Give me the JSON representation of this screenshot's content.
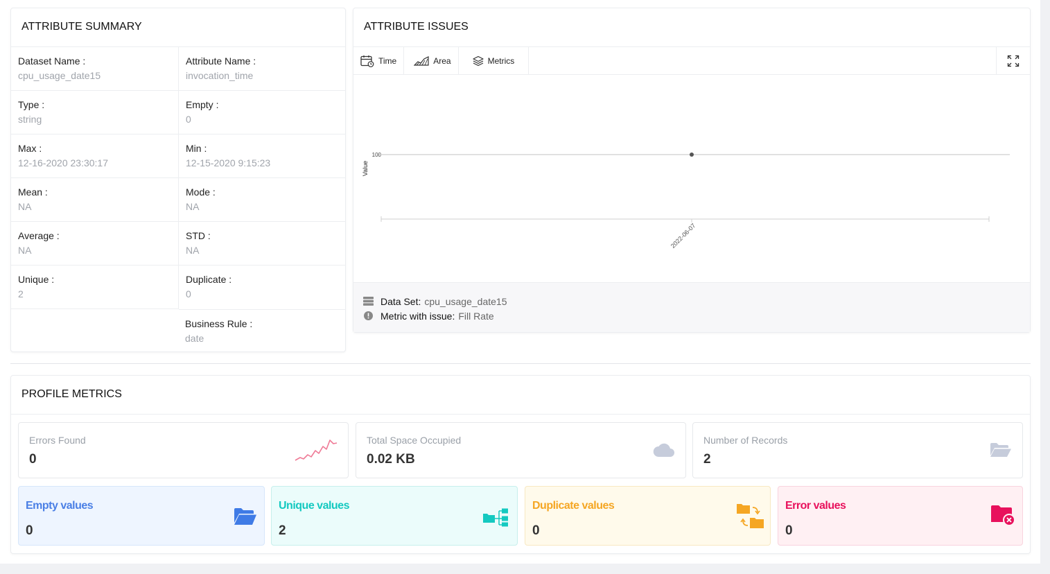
{
  "summary": {
    "title": "ATTRIBUTE SUMMARY",
    "fields": [
      {
        "label": "Dataset Name :",
        "value": "cpu_usage_date15"
      },
      {
        "label": "Attribute Name :",
        "value": "invocation_time"
      },
      {
        "label": "Type :",
        "value": "string"
      },
      {
        "label": "Empty :",
        "value": "0"
      },
      {
        "label": "Max :",
        "value": "12-16-2020 23:30:17"
      },
      {
        "label": "Min :",
        "value": "12-15-2020 9:15:23"
      },
      {
        "label": "Mean :",
        "value": "NA"
      },
      {
        "label": "Mode :",
        "value": "NA"
      },
      {
        "label": "Average :",
        "value": "NA"
      },
      {
        "label": "STD :",
        "value": "NA"
      },
      {
        "label": "Unique :",
        "value": "2"
      },
      {
        "label": "Duplicate :",
        "value": "0"
      }
    ],
    "business_rule": {
      "label": "Business Rule :",
      "value": "date"
    }
  },
  "issues": {
    "title": "ATTRIBUTE ISSUES",
    "toolbar": {
      "time": "Time",
      "area": "Area",
      "metrics": "Metrics"
    },
    "footer": {
      "dataset_label": "Data Set:",
      "dataset_value": "cpu_usage_date15",
      "metric_label": "Metric with issue:",
      "metric_value": "Fill Rate"
    }
  },
  "chart_data": {
    "type": "line",
    "x": [
      "2022-06-07"
    ],
    "series": [
      {
        "values": [
          100
        ]
      }
    ],
    "ylabel": "Value",
    "yticks": [
      "100"
    ],
    "grid": false,
    "color": "#555555"
  },
  "profile": {
    "title": "PROFILE METRICS",
    "stats": [
      {
        "label": "Errors Found",
        "value": "0",
        "icon": "trend-line-icon"
      },
      {
        "label": "Total Space Occupied",
        "value": "0.02 KB",
        "icon": "cloud-icon"
      },
      {
        "label": "Number of Records",
        "value": "2",
        "icon": "open-folder-icon"
      }
    ],
    "tiles": [
      {
        "label": "Empty values",
        "value": "0",
        "color": "#4a7fe5",
        "bg": "#eef5ff",
        "border": "#d6e6fb"
      },
      {
        "label": "Unique values",
        "value": "2",
        "color": "#14c9c0",
        "bg": "#ebfcfb",
        "border": "#c7efec"
      },
      {
        "label": "Duplicate values",
        "value": "0",
        "color": "#f5a623",
        "bg": "#fffaeb",
        "border": "#f8e8c2"
      },
      {
        "label": "Error values",
        "value": "0",
        "color": "#e8115c",
        "bg": "#fff0f3",
        "border": "#f9d3de"
      }
    ]
  }
}
